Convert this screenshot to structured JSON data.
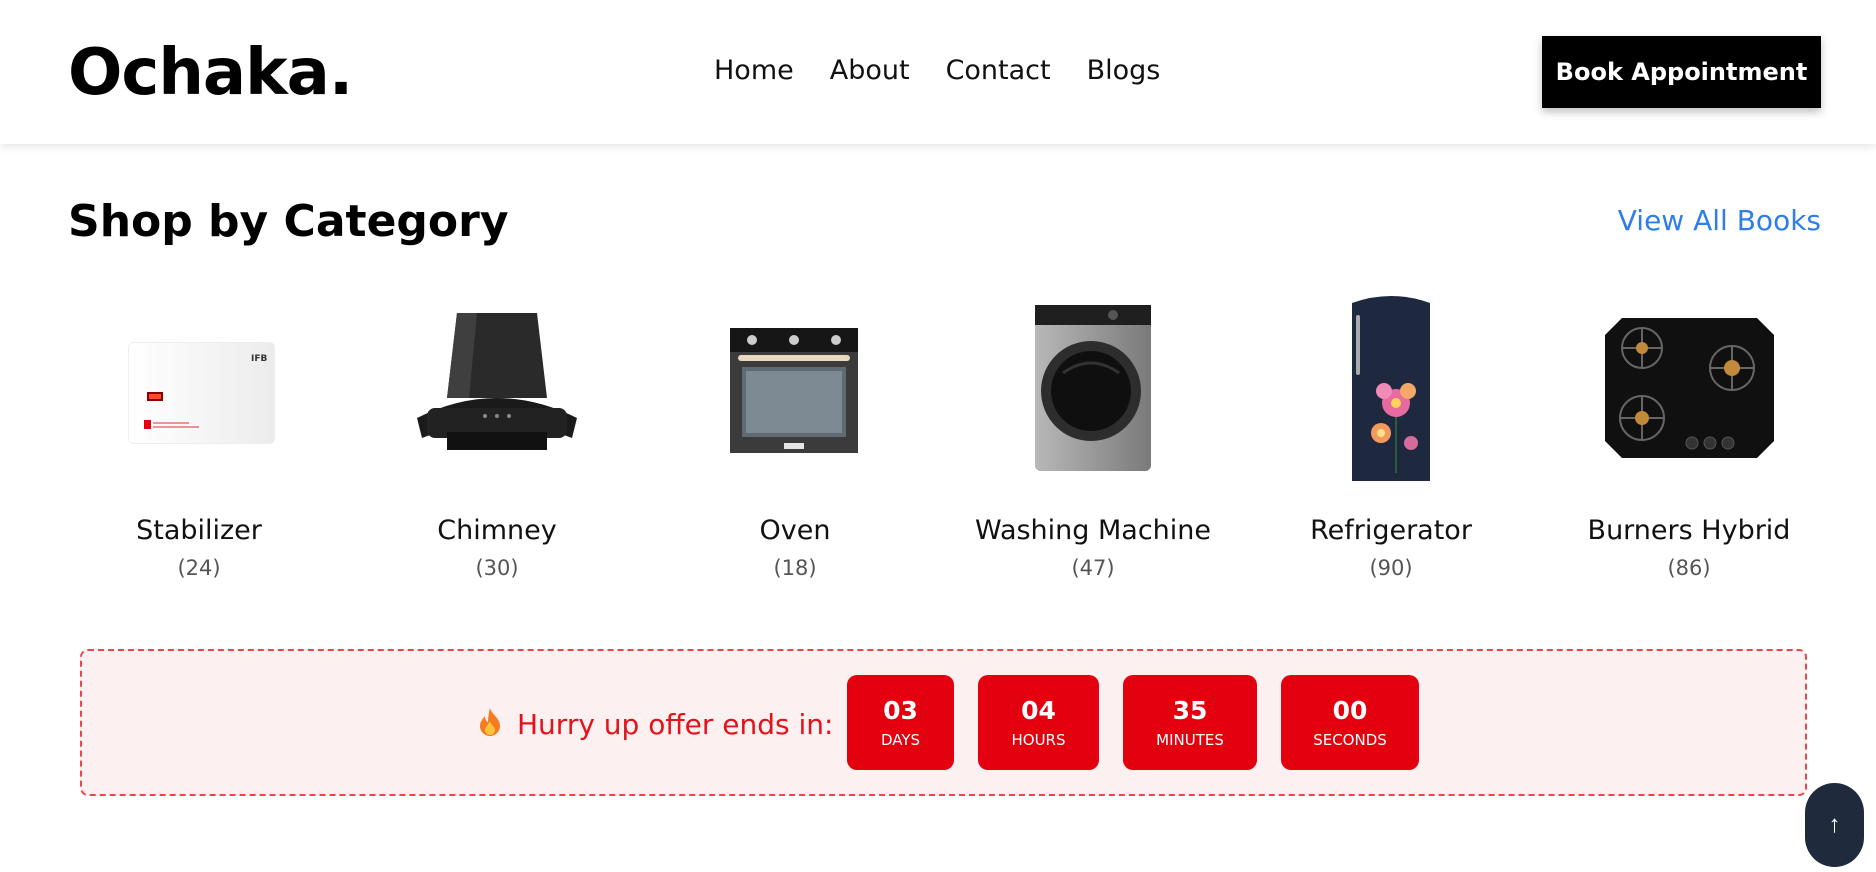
{
  "header": {
    "logo": "Ochaka.",
    "nav": [
      "Home",
      "About",
      "Contact",
      "Blogs"
    ],
    "cta": "Book Appointment"
  },
  "section": {
    "title": "Shop by Category",
    "view_all": "View All Books"
  },
  "categories": [
    {
      "name": "Stabilizer",
      "count": "(24)",
      "icon": "stabilizer-image"
    },
    {
      "name": "Chimney",
      "count": "(30)",
      "icon": "chimney-image"
    },
    {
      "name": "Oven",
      "count": "(18)",
      "icon": "oven-image"
    },
    {
      "name": "Washing Machine",
      "count": "(47)",
      "icon": "washing-machine-image"
    },
    {
      "name": "Refrigerator",
      "count": "(90)",
      "icon": "refrigerator-image"
    },
    {
      "name": "Burners Hybrid",
      "count": "(86)",
      "icon": "burners-hybrid-image"
    }
  ],
  "offer": {
    "icon": "fire-icon",
    "label": "Hurry up offer ends in:",
    "timer": [
      {
        "value": "03",
        "unit": "DAYS"
      },
      {
        "value": "04",
        "unit": "HOURS"
      },
      {
        "value": "35",
        "unit": "MINUTES"
      },
      {
        "value": "00",
        "unit": "SECONDS"
      }
    ]
  },
  "scroll_top": {
    "icon": "arrow-up-icon",
    "glyph": "↑"
  },
  "colors": {
    "accent_blue": "#2f7ee8",
    "offer_red": "#e3000f",
    "offer_bg": "#fdf0f0",
    "scroll_button": "#1f2a3c"
  }
}
